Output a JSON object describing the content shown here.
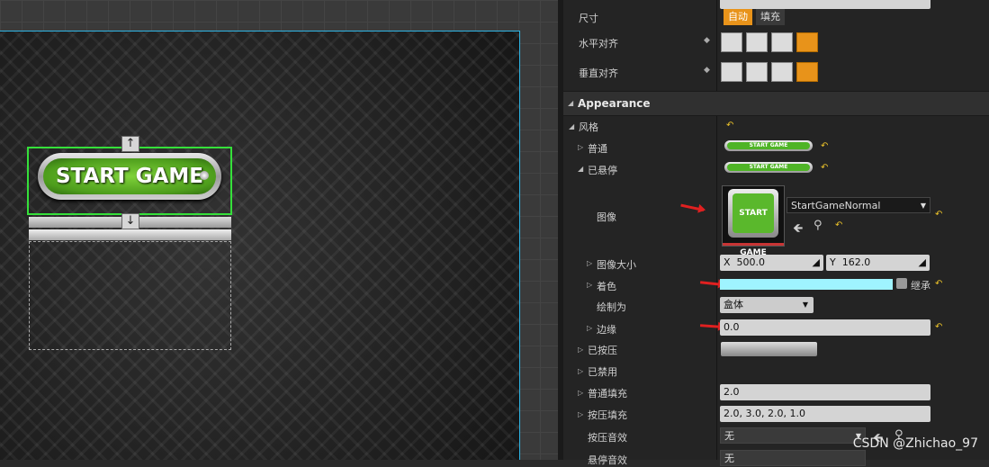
{
  "viewport": {
    "button_text": "START GAME",
    "up_arrow": "↑",
    "down_arrow": "↓"
  },
  "details": {
    "size": {
      "label": "尺寸",
      "auto": "自动",
      "fill": "填充"
    },
    "h_align": {
      "label": "水平对齐"
    },
    "v_align": {
      "label": "垂直对齐"
    },
    "appearance": {
      "label": "Appearance"
    },
    "style": {
      "label": "风格"
    },
    "normal": {
      "label": "普通",
      "thumb_text": "START GAME"
    },
    "hovered": {
      "label": "已悬停",
      "thumb_text": "START GAME"
    },
    "image": {
      "label": "图像",
      "asset": "StartGameNormal",
      "thumb_text": "START GAME"
    },
    "image_size": {
      "label": "图像大小",
      "x_label": "X",
      "x": "500.0",
      "y_label": "Y",
      "y": "162.0"
    },
    "tint": {
      "label": "着色",
      "inherit": "继承",
      "color": "#9ff4ff"
    },
    "draw_as": {
      "label": "绘制为",
      "value": "盒体"
    },
    "margin": {
      "label": "边缘",
      "value": "0.0"
    },
    "pressed": {
      "label": "已按压"
    },
    "disabled": {
      "label": "已禁用"
    },
    "normal_padding": {
      "label": "普通填充",
      "value": "2.0"
    },
    "pressed_padding": {
      "label": "按压填充",
      "value": "2.0, 3.0, 2.0, 1.0"
    },
    "pressed_sound": {
      "label": "按压音效",
      "value": "无"
    },
    "hovered_sound": {
      "label": "悬停音效",
      "value": "无"
    }
  },
  "watermark": "CSDN @Zhichao_97",
  "colors": {
    "accent": "#e8931a",
    "selection": "#35e03a",
    "canvas_border": "#2fb6e6"
  }
}
